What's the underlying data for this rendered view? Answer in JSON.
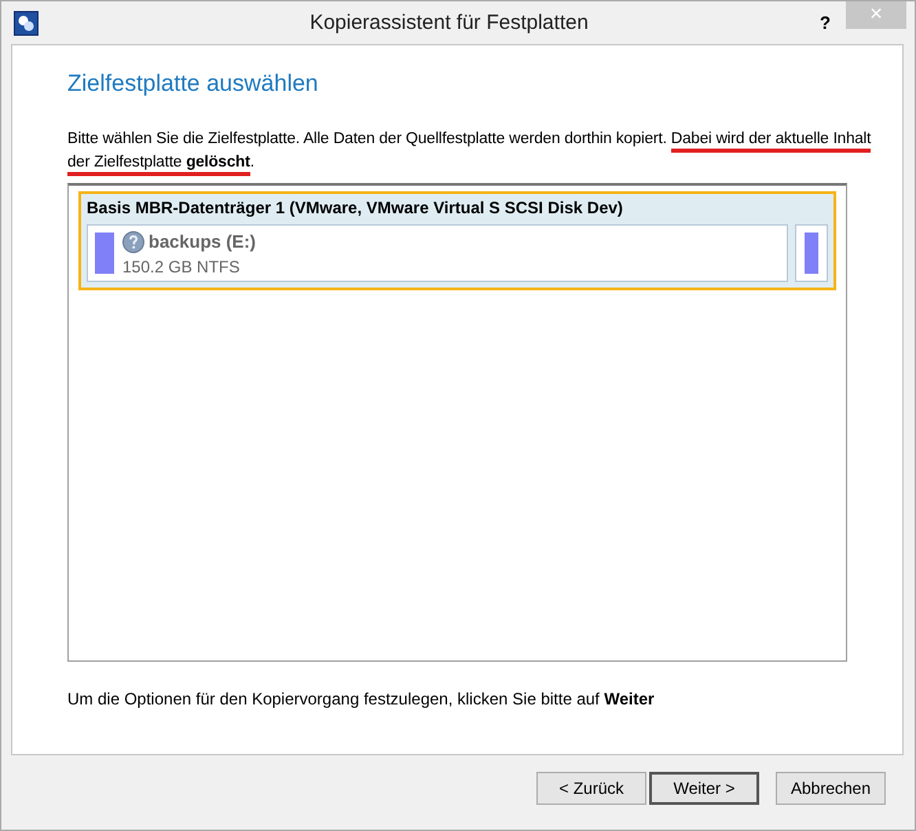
{
  "window": {
    "title": "Kopierassistent für Festplatten",
    "help": "?",
    "close": "×"
  },
  "heading": "Zielfestplatte auswählen",
  "intro": [
    {
      "text": "Bitte wählen Sie die Zielfestplatte. Alle Daten der Quellfestplatte werden dorthin kopiert. ",
      "underlined": false
    },
    {
      "text": "Dabei wird der aktuelle Inhalt ",
      "underlined": true
    },
    {
      "text": "der Zielfestplatte **gelöscht**",
      "underlined": true
    },
    {
      "text": ".",
      "underlined": false
    }
  ],
  "disks": [
    {
      "title": "Basis MBR-Datenträger 1 (VMware, VMware Virtual S SCSI Disk Dev)",
      "selected": true,
      "partitions": [
        {
          "name": "backups (E:)",
          "size": "150.2 GB NTFS"
        }
      ]
    }
  ],
  "hint": "Um die Optionen für den Kopiervorgang festzulegen, klicken Sie bitte auf **Weiter**",
  "buttons": [
    {
      "label": "< Zurück",
      "default": false
    },
    {
      "label": "Weiter >",
      "default": true
    },
    {
      "label": "Abbrechen",
      "default": false
    }
  ]
}
